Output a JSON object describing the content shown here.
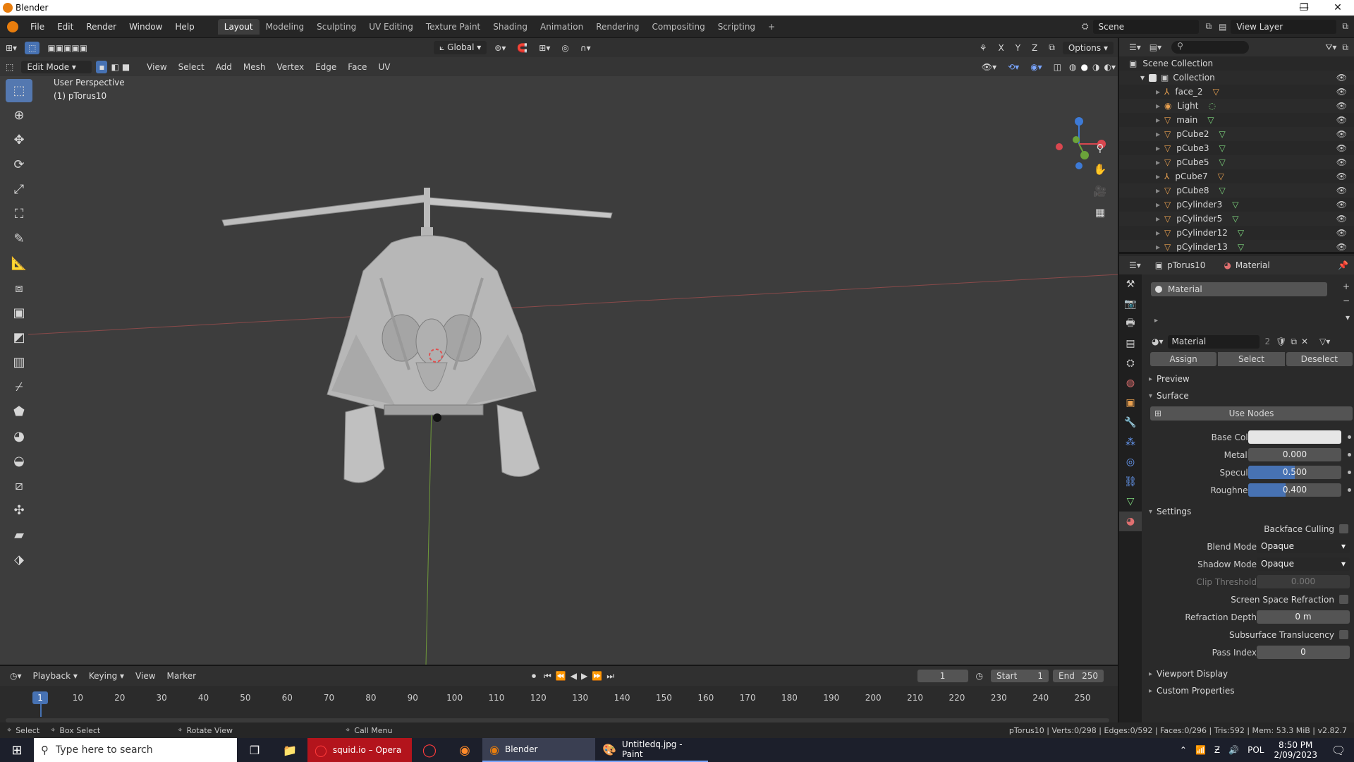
{
  "window": {
    "title": "Blender",
    "minimize": "—",
    "maximize": "❐",
    "close": "✕"
  },
  "menu": [
    "File",
    "Edit",
    "Render",
    "Window",
    "Help"
  ],
  "workspaces": [
    "Layout",
    "Modeling",
    "Sculpting",
    "UV Editing",
    "Texture Paint",
    "Shading",
    "Animation",
    "Rendering",
    "Compositing",
    "Scripting"
  ],
  "scene": {
    "name": "Scene",
    "view_layer": "View Layer"
  },
  "viewport": {
    "mode": "Edit Mode",
    "header_menus": [
      "View",
      "Select",
      "Add",
      "Mesh",
      "Vertex",
      "Edge",
      "Face",
      "UV"
    ],
    "transform_orientation": "Global",
    "options_label": "Options",
    "perspective_label": "User Perspective",
    "object_label": "(1) pTorus10",
    "axis_x": "X",
    "axis_y": "Y",
    "axis_z": "Z"
  },
  "outliner": {
    "root": "Scene Collection",
    "collection": "Collection",
    "items": [
      "face_2",
      "Light",
      "main",
      "pCube2",
      "pCube3",
      "pCube5",
      "pCube7",
      "pCube8",
      "pCylinder3",
      "pCylinder5",
      "pCylinder12",
      "pCylinder13"
    ]
  },
  "properties": {
    "object": "pTorus10",
    "tab_label": "Material",
    "slot": "Material",
    "material_name": "Material",
    "user_count": "2",
    "assign": "Assign",
    "select": "Select",
    "deselect": "Deselect",
    "preview": "Preview",
    "surface": "Surface",
    "use_nodes": "Use Nodes",
    "base_color_label": "Base Color",
    "base_color": "#e6e6e6",
    "metallic_label": "Metallic",
    "metallic": "0.000",
    "metallic_fill": 0,
    "specular_label": "Specular",
    "specular": "0.500",
    "specular_fill": 0.5,
    "roughness_label": "Roughness",
    "roughness": "0.400",
    "roughness_fill": 0.4,
    "settings": "Settings",
    "backface_culling": "Backface Culling",
    "blend_mode_label": "Blend Mode",
    "blend_mode": "Opaque",
    "shadow_mode_label": "Shadow Mode",
    "shadow_mode": "Opaque",
    "clip_threshold_label": "Clip Threshold",
    "clip_threshold": "0.000",
    "ssr": "Screen Space Refraction",
    "refraction_depth_label": "Refraction Depth",
    "refraction_depth": "0 m",
    "subsurface": "Subsurface Translucency",
    "pass_index_label": "Pass Index",
    "pass_index": "0",
    "viewport_display": "Viewport Display",
    "custom_properties": "Custom Properties"
  },
  "timeline": {
    "menus": [
      "Playback",
      "Keying",
      "View",
      "Marker"
    ],
    "current_frame": "1",
    "start_label": "Start",
    "start": "1",
    "end_label": "End",
    "end": "250",
    "ticks": [
      "1",
      "10",
      "20",
      "30",
      "40",
      "50",
      "60",
      "70",
      "80",
      "90",
      "100",
      "110",
      "120",
      "130",
      "140",
      "150",
      "160",
      "170",
      "180",
      "190",
      "200",
      "210",
      "220",
      "230",
      "240",
      "250"
    ]
  },
  "statusbar": {
    "select": "Select",
    "box_select": "Box Select",
    "rotate_view": "Rotate View",
    "call_menu": "Call Menu",
    "stats": "pTorus10 | Verts:0/298 | Edges:0/592 | Faces:0/296 | Tris:592 | Mem: 53.3 MiB | v2.82.7"
  },
  "taskbar": {
    "search_placeholder": "Type here to search",
    "opera": "squid.io – Opera",
    "blender": "Blender",
    "paint": "Untitledq.jpg - Paint",
    "lang": "POL",
    "time": "8:50 PM",
    "date": "2/09/2023"
  },
  "colors": {
    "accent": "#4772b3",
    "orange": "#e87d0d",
    "viewport_bg": "#3d3d3d"
  }
}
